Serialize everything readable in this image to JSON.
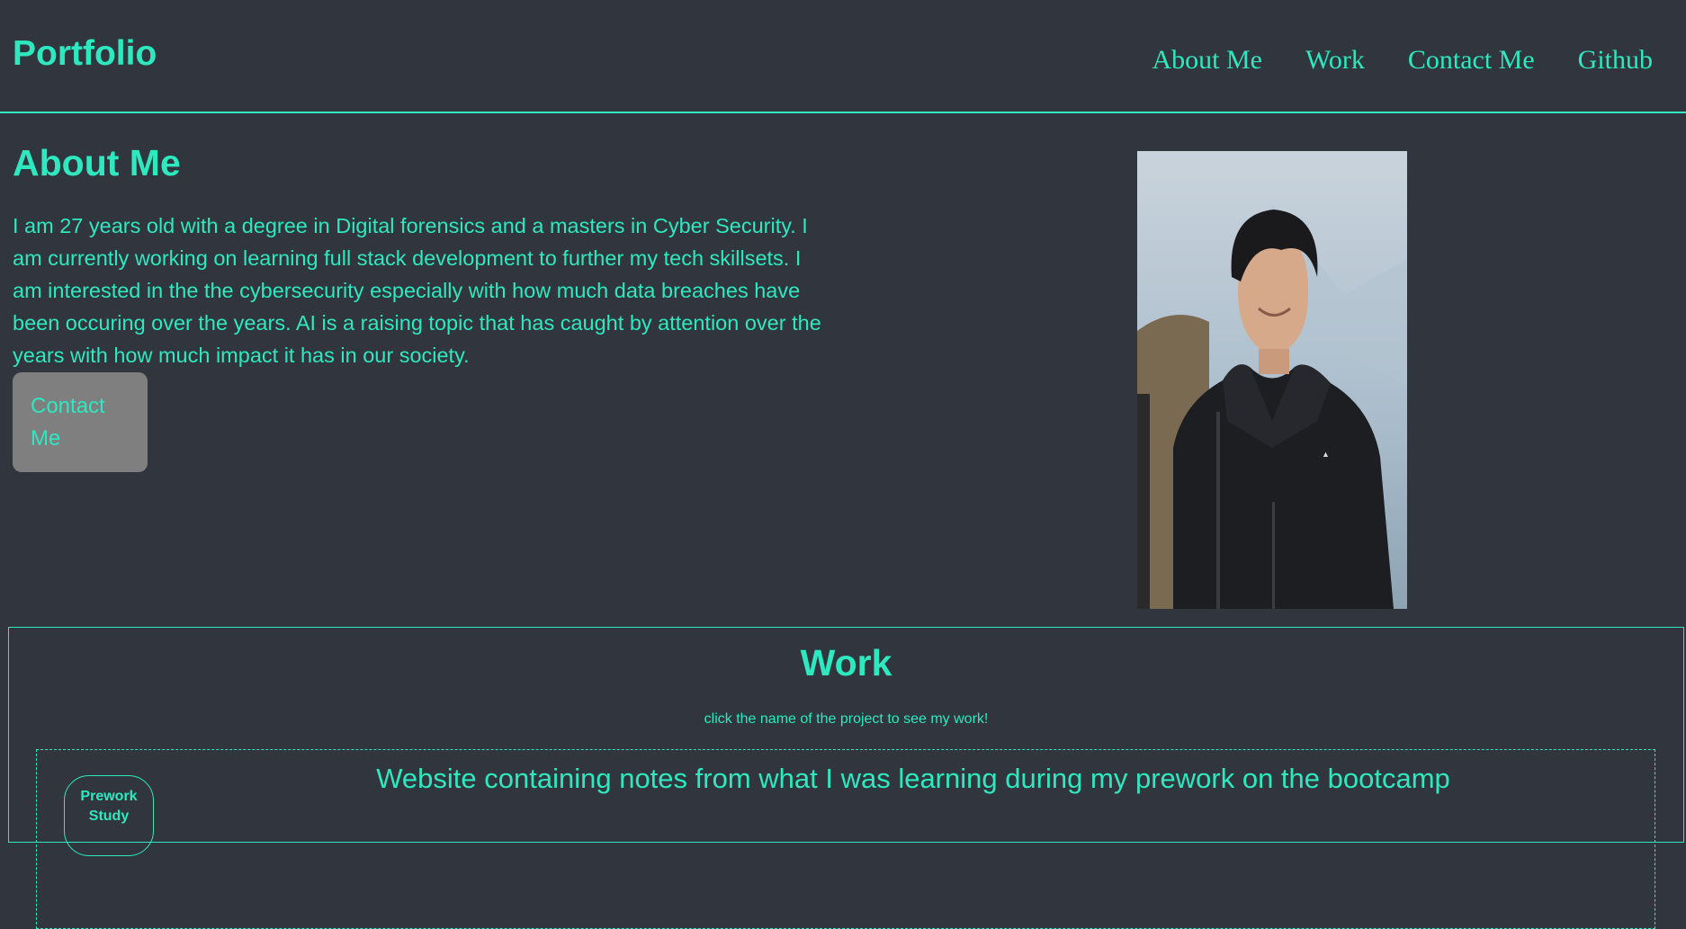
{
  "header": {
    "brand": "Portfolio",
    "nav": [
      "About Me",
      "Work",
      "Contact Me",
      "Github"
    ]
  },
  "about": {
    "heading": "About Me",
    "text": "I am 27 years old with a degree in Digital forensics and a masters in Cyber Security. I am currently working on learning full stack development to further my tech skillsets. I am interested in the the cybersecurity especially with how much data breaches have been occuring over the years. AI is a raising topic that has caught by attention over the years with how much impact it has in our society.",
    "contact_button": "Contact Me"
  },
  "work": {
    "heading": "Work",
    "hint": "click the name of the project to see my work!",
    "projects": [
      {
        "button_label": "Prework Study",
        "title": "Website containing notes from what I was learning during my prework on the bootcamp"
      }
    ]
  },
  "colors": {
    "background": "#31363e",
    "accent": "#2ee8c0",
    "button_bg": "#7f7f7f"
  }
}
